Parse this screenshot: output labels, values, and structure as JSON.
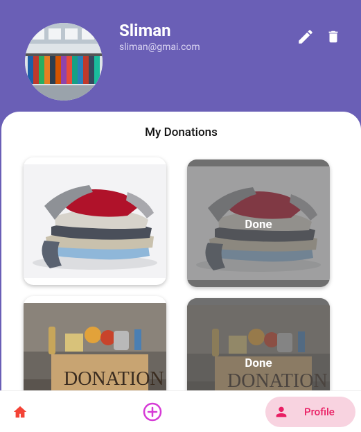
{
  "profile": {
    "name": "Sliman",
    "email": "sliman@gmai.com"
  },
  "actions": {
    "edit_icon": "pencil-icon",
    "delete_icon": "trash-icon"
  },
  "donations": {
    "title": "My Donations",
    "items": [
      {
        "image": "folded-clothes",
        "status": ""
      },
      {
        "image": "folded-clothes",
        "status": "Done"
      },
      {
        "image": "donation-box-food",
        "status": ""
      },
      {
        "image": "donation-box-food",
        "status": "Done"
      }
    ]
  },
  "nav": {
    "home_icon": "home-icon",
    "add_icon": "add-circle-icon",
    "profile_label": "Profile",
    "profile_icon": "person-icon"
  },
  "colors": {
    "header": "#6a5fb6",
    "accent": "#e91e63",
    "add_icon": "#d63ad6",
    "home_icon": "#f44336",
    "profile_pill": "#f8d3e0"
  }
}
